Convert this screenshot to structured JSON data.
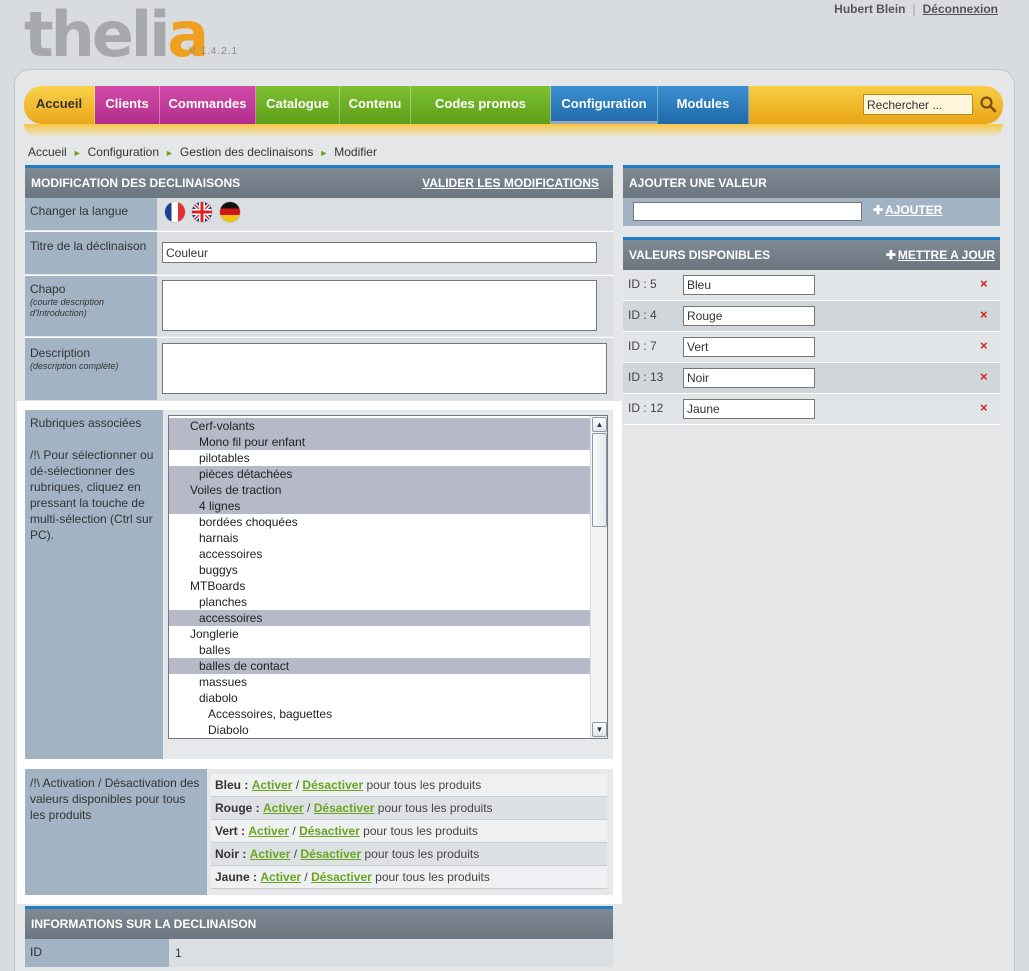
{
  "header": {
    "logo_main": "thel",
    "logo_i": "i",
    "logo_a": "a",
    "version": "V 1.4.2.1",
    "user_name": "Hubert Blein",
    "separator": "|",
    "logout": "Déconnexion"
  },
  "nav": {
    "items": [
      {
        "label": "Accueil",
        "color": "#f2bc30"
      },
      {
        "label": "Clients",
        "color": "#c23c9a"
      },
      {
        "label": "Commandes",
        "color": "#c23c9a"
      },
      {
        "label": "Catalogue",
        "color": "#6aa820"
      },
      {
        "label": "Contenu",
        "color": "#6aa820"
      },
      {
        "label": "Codes promos",
        "color": "#6aa820"
      },
      {
        "label": "Configuration",
        "color": "#2a79b8"
      },
      {
        "label": "Modules",
        "color": "#2a79b8"
      }
    ],
    "search_placeholder": "Rechercher ..."
  },
  "breadcrumb": [
    "Accueil",
    "Configuration",
    "Gestion des declinaisons",
    "Modifier"
  ],
  "left_panel": {
    "title": "MODIFICATION DES DECLINAISONS",
    "action": "VALIDER LES MODIFICATIONS",
    "lang_label": "Changer la langue",
    "title_label": "Titre de la déclinaison",
    "title_value": "Couleur",
    "chapo_label": "Chapo",
    "chapo_hint": "(courte description d'Introduction)",
    "desc_label": "Description",
    "desc_hint": "(description complète)",
    "rubriques_label": "Rubriques associées",
    "rubriques_help": "/!\\ Pour sélectionner ou dé-sélectionner des rubriques, cliquez en pressant la touche de multi-sélection (Ctrl sur PC).",
    "rubriques": [
      {
        "label": "Cerf-volants",
        "indent": 1,
        "selected": true
      },
      {
        "label": "Mono fil pour enfant",
        "indent": 2,
        "selected": true
      },
      {
        "label": "pilotables",
        "indent": 2,
        "selected": false
      },
      {
        "label": "pièces détachées",
        "indent": 2,
        "selected": true
      },
      {
        "label": "Voiles de traction",
        "indent": 1,
        "selected": true
      },
      {
        "label": "4 lignes",
        "indent": 2,
        "selected": true
      },
      {
        "label": "bordées choquées",
        "indent": 2,
        "selected": false
      },
      {
        "label": "harnais",
        "indent": 2,
        "selected": false
      },
      {
        "label": "accessoires",
        "indent": 2,
        "selected": false
      },
      {
        "label": "buggys",
        "indent": 2,
        "selected": false
      },
      {
        "label": "MTBoards",
        "indent": 1,
        "selected": false
      },
      {
        "label": "planches",
        "indent": 2,
        "selected": false
      },
      {
        "label": "accessoires",
        "indent": 2,
        "selected": true
      },
      {
        "label": "Jonglerie",
        "indent": 1,
        "selected": false
      },
      {
        "label": "balles",
        "indent": 2,
        "selected": false
      },
      {
        "label": "balles de contact",
        "indent": 2,
        "selected": true
      },
      {
        "label": "massues",
        "indent": 2,
        "selected": false
      },
      {
        "label": "diabolo",
        "indent": 2,
        "selected": false
      },
      {
        "label": "Accessoires, baguettes",
        "indent": 3,
        "selected": false
      },
      {
        "label": "Diabolo",
        "indent": 3,
        "selected": false
      }
    ],
    "activation_label": "/!\\ Activation / Désactivation des valeurs disponibles pour tous les produits",
    "activation_rows": [
      {
        "name": "Bleu :",
        "activate": "Activer",
        "slash": "/",
        "deactivate": "Désactiver",
        "suffix": "pour tous les produits"
      },
      {
        "name": "Rouge :",
        "activate": "Activer",
        "slash": "/",
        "deactivate": "Désactiver",
        "suffix": "pour tous les produits"
      },
      {
        "name": "Vert :",
        "activate": "Activer",
        "slash": "/",
        "deactivate": "Désactiver",
        "suffix": "pour tous les produits"
      },
      {
        "name": "Noir :",
        "activate": "Activer",
        "slash": "/",
        "deactivate": "Désactiver",
        "suffix": "pour tous les produits"
      },
      {
        "name": "Jaune :",
        "activate": "Activer",
        "slash": "/",
        "deactivate": "Désactiver",
        "suffix": "pour tous les produits"
      }
    ]
  },
  "info_panel": {
    "title": "INFORMATIONS SUR LA DECLINAISON",
    "id_label": "ID",
    "id_value": "1"
  },
  "right_panel": {
    "add_title": "AJOUTER UNE VALEUR",
    "add_button": "AJOUTER",
    "values_title": "VALEURS DISPONIBLES",
    "update_button": "METTRE A JOUR",
    "values": [
      {
        "id": "ID : 5",
        "value": "Bleu"
      },
      {
        "id": "ID : 4",
        "value": "Rouge"
      },
      {
        "id": "ID : 7",
        "value": "Vert"
      },
      {
        "id": "ID : 13",
        "value": "Noir"
      },
      {
        "id": "ID : 12",
        "value": "Jaune"
      }
    ],
    "delete_glyph": "×"
  }
}
